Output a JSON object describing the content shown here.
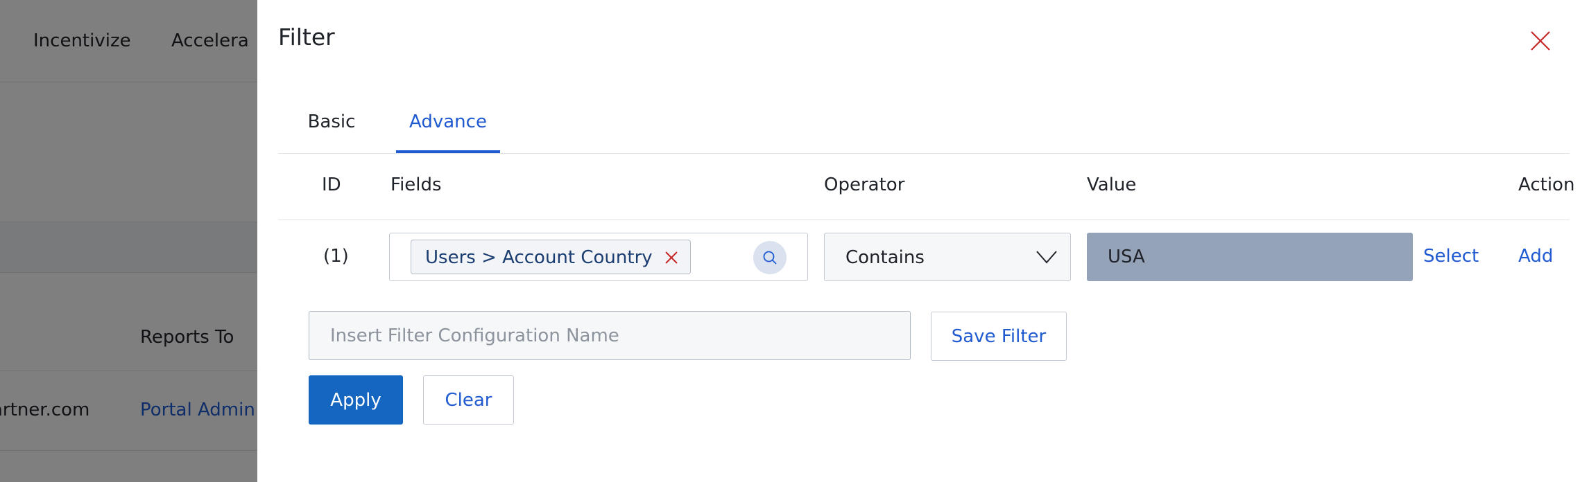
{
  "background": {
    "nav_items": [
      "Incentivize",
      "Accelera"
    ],
    "table_header": "Reports To",
    "row_email": "artner.com",
    "row_link": "Portal Admin"
  },
  "drawer": {
    "title": "Filter",
    "tabs": [
      {
        "label": "Basic",
        "active": false
      },
      {
        "label": "Advance",
        "active": true
      }
    ],
    "columns": {
      "id": "ID",
      "fields": "Fields",
      "operator": "Operator",
      "value": "Value",
      "action": "Action"
    },
    "rows": [
      {
        "id": "(1)",
        "field_chip": "Users > Account Country",
        "operator": "Contains",
        "value": "USA",
        "select_label": "Select",
        "action_label": "Add"
      }
    ],
    "config_placeholder": "Insert Filter Configuration Name",
    "config_value": "",
    "save_filter_label": "Save Filter",
    "apply_label": "Apply",
    "clear_label": "Clear"
  },
  "icons": {
    "close": "close-icon",
    "chip_remove": "remove-icon",
    "search": "search-icon",
    "chevron": "chevron-down-icon"
  },
  "colors": {
    "accent": "#1f5ad1",
    "primary_button": "#1466c0",
    "close_icon": "#c62828",
    "value_box": "#95a3b8"
  }
}
